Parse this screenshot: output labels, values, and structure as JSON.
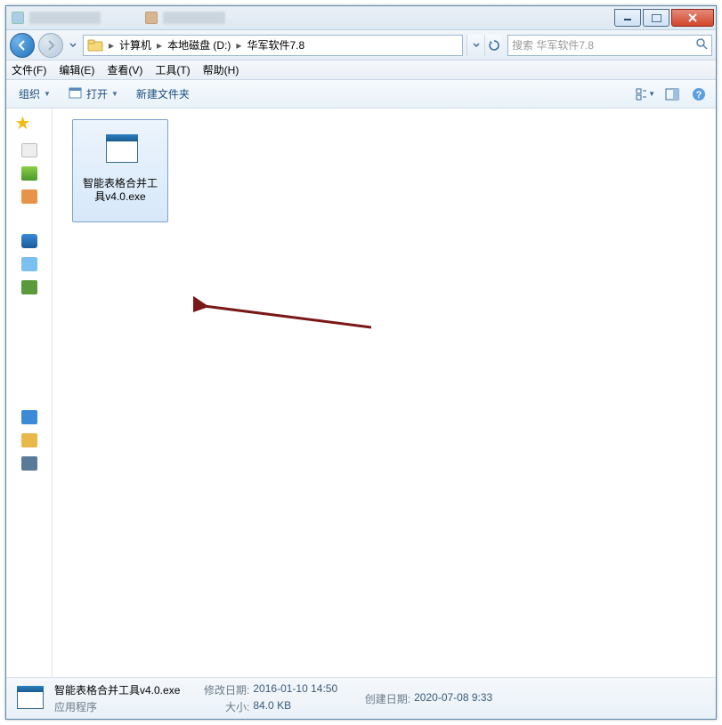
{
  "breadcrumb": {
    "parts": [
      "计算机",
      "本地磁盘 (D:)",
      "华军软件7.8"
    ]
  },
  "search": {
    "placeholder": "搜索 华军软件7.8"
  },
  "menubar": {
    "file": "文件(F)",
    "edit": "编辑(E)",
    "view": "查看(V)",
    "tools": "工具(T)",
    "help": "帮助(H)"
  },
  "toolbar": {
    "organize": "组织",
    "open": "打开",
    "new_folder": "新建文件夹"
  },
  "file": {
    "name_line1": "智能表格合并工",
    "name_line2": "具v4.0.exe"
  },
  "details": {
    "filename": "智能表格合并工具v4.0.exe",
    "filetype": "应用程序",
    "modified_label": "修改日期:",
    "modified_value": "2016-01-10 14:50",
    "size_label": "大小:",
    "size_value": "84.0 KB",
    "created_label": "创建日期:",
    "created_value": "2020-07-08 9:33"
  }
}
